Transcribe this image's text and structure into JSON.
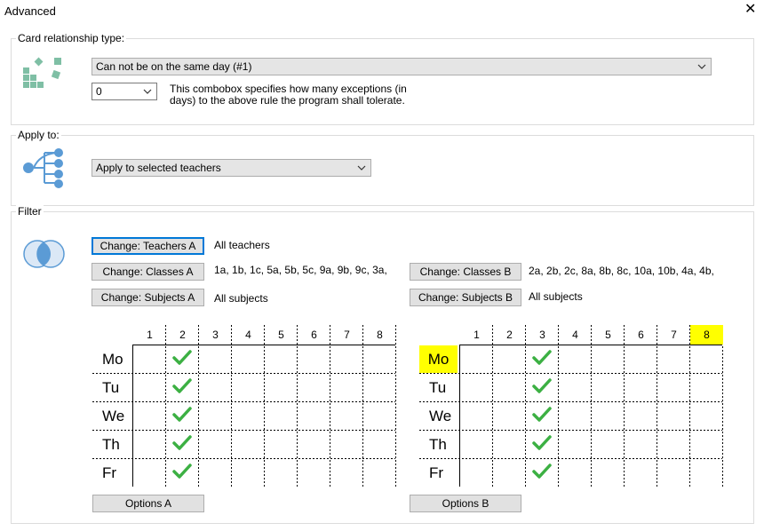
{
  "window": {
    "title": "Advanced"
  },
  "relationship": {
    "legend": "Card relationship type:",
    "type_value": "Can not be on the same day (#1)",
    "exceptions_value": "0",
    "help_line1": "This combobox specifies how many exceptions (in",
    "help_line2": "days) to the above rule the program shall tolerate."
  },
  "apply": {
    "legend": "Apply to:",
    "value": "Apply to selected teachers"
  },
  "filter": {
    "legend": "Filter",
    "teachers_a_button": "Change: Teachers A",
    "teachers_a_value": "All teachers",
    "classes_a_button": "Change: Classes A",
    "classes_a_value": "1a, 1b, 1c, 5a, 5b, 5c, 9a, 9b, 9c, 3a,",
    "subjects_a_button": "Change: Subjects A",
    "subjects_a_value": "All subjects",
    "classes_b_button": "Change: Classes B",
    "classes_b_value": "2a, 2b, 2c, 8a, 8b, 8c, 10a, 10b, 4a, 4b,",
    "subjects_b_button": "Change: Subjects B",
    "subjects_b_value": "All subjects",
    "options_a_button": "Options A",
    "options_b_button": "Options B"
  },
  "grid_a": {
    "periods": [
      "1",
      "2",
      "3",
      "4",
      "5",
      "6",
      "7",
      "8"
    ],
    "days": [
      "Mo",
      "Tu",
      "We",
      "Th",
      "Fr"
    ],
    "checked_period": "2",
    "highlight_day": "",
    "highlight_period": ""
  },
  "grid_b": {
    "periods": [
      "1",
      "2",
      "3",
      "4",
      "5",
      "6",
      "7",
      "8"
    ],
    "days": [
      "Mo",
      "Tu",
      "We",
      "Th",
      "Fr"
    ],
    "checked_period": "3",
    "highlight_day": "Mo",
    "highlight_period": "8"
  },
  "colors": {
    "check": "#3cb043",
    "highlight": "#ffff00",
    "accent": "#0078d7",
    "icon_teal": "#7fbfa5",
    "icon_blue": "#5b9bd5"
  }
}
